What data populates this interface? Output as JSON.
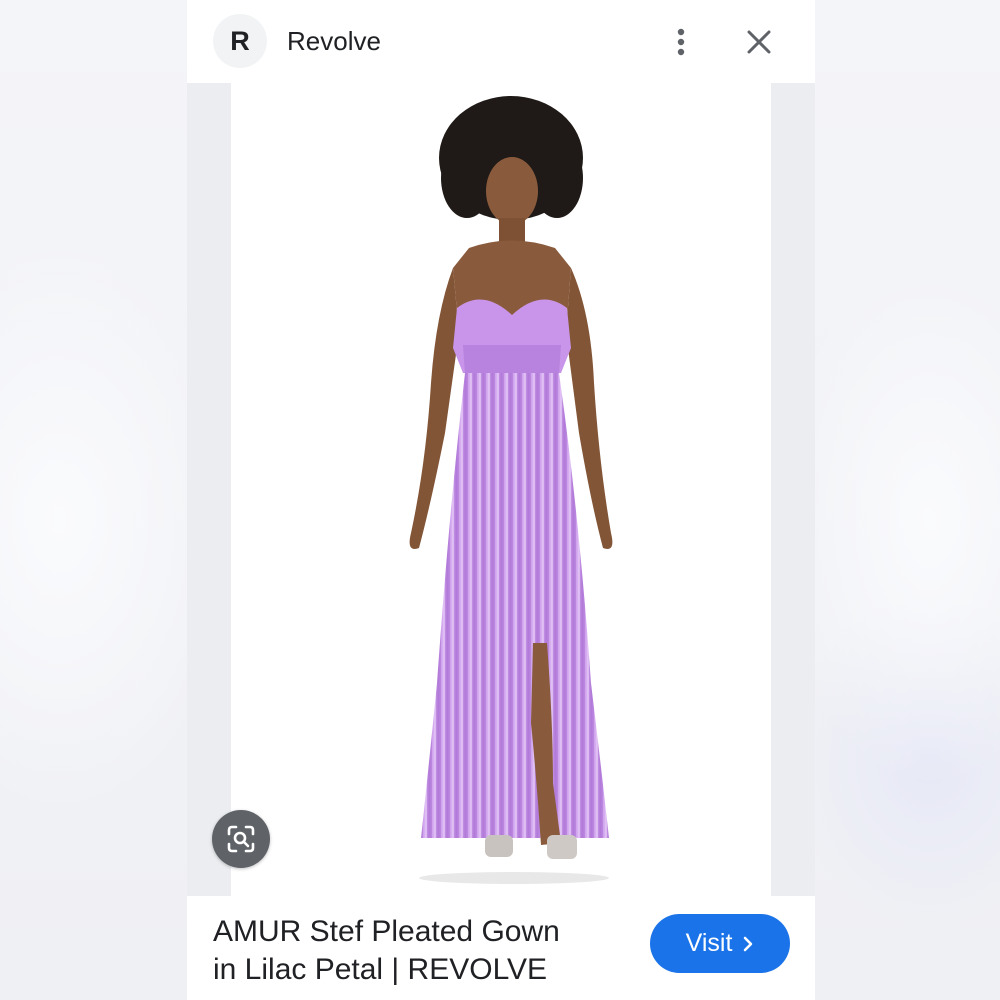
{
  "header": {
    "logo_letter": "R",
    "source_name": "Revolve",
    "more_icon": "more-vert-icon",
    "close_icon": "close-icon"
  },
  "image": {
    "lens_icon": "lens-search-icon",
    "dress_color": "#c48fe6"
  },
  "result": {
    "title_line1": "AMUR Stef Pleated Gown",
    "title_line2": "in Lilac Petal | REVOLVE"
  },
  "actions": {
    "visit_label": "Visit",
    "visit_icon": "chevron-right-icon"
  },
  "colors": {
    "accent": "#1a73e8",
    "text": "#202124"
  }
}
